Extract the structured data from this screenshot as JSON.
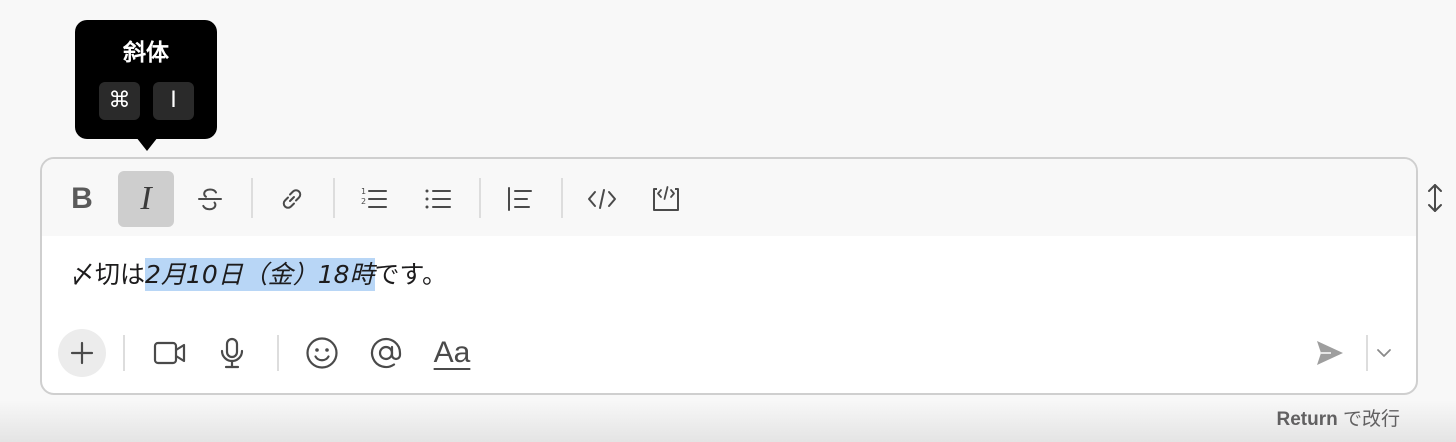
{
  "tooltip": {
    "title": "斜体",
    "key_cmd": "⌘",
    "key_letter": "I"
  },
  "toolbar": {
    "bold_label": "B",
    "italic_label": "I",
    "active_button": "italic"
  },
  "editor": {
    "text_before": "〆切は",
    "text_selected": "2月10日（金）18時",
    "text_after": "です。"
  },
  "bottom": {
    "format_label": "Aa"
  },
  "hint": {
    "key": "Return",
    "action": "で改行"
  },
  "colors": {
    "selection": "#b8d6f6",
    "tooltip_bg": "#000000",
    "active_button_bg": "#cecece"
  }
}
